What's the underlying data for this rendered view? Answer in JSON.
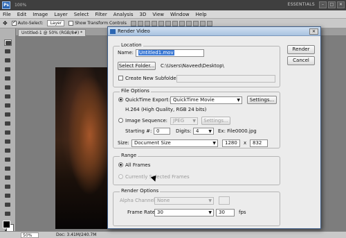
{
  "app": {
    "logo": "Ps",
    "zoom": "100%",
    "workspace": "ESSENTIALS",
    "window_buttons": [
      "–",
      "□",
      "✕"
    ]
  },
  "menu": [
    "File",
    "Edit",
    "Image",
    "Layer",
    "Select",
    "Filter",
    "Analysis",
    "3D",
    "View",
    "Window",
    "Help"
  ],
  "options_bar": {
    "auto_select_label": "Auto-Select:",
    "auto_select_value": "Layer",
    "transform_label": "Show Transform Controls"
  },
  "document": {
    "tab_title": "Untitled-1 @ 50% (RGB/8#) *",
    "zoom": "50%",
    "doc_size": "Doc: 3.41M/240.7M"
  },
  "dialog": {
    "title": "Render Video",
    "render_button": "Render",
    "cancel_button": "Cancel",
    "location": {
      "group_label": "Location",
      "name_label": "Name:",
      "name_value": "Untitled1.mov",
      "select_folder_button": "Select Folder...",
      "folder_path": "C:\\Users\\Naveed\\Desktop\\",
      "create_subfolder_label": "Create New Subfolder:"
    },
    "file_options": {
      "group_label": "File Options",
      "quicktime_label": "QuickTime Export:",
      "quicktime_format": "QuickTime Movie",
      "settings_button": "Settings...",
      "codec_info": "H.264 (High Quality, RGB 24 bits)",
      "image_sequence_label": "Image Sequence:",
      "image_sequence_format": "JPEG",
      "settings_button_2": "Settings...",
      "starting_label": "Starting #:",
      "starting_value": "0",
      "digits_label": "Digits:",
      "digits_value": "4",
      "example": "Ex: File0000.jpg",
      "size_label": "Size:",
      "size_value": "Document Size",
      "width_value": "1280",
      "times": "x",
      "height_value": "832"
    },
    "range": {
      "group_label": "Range",
      "all_frames_label": "All Frames",
      "selected_frames_label": "Currently Selected Frames"
    },
    "render_options": {
      "group_label": "Render Options",
      "alpha_label": "Alpha Channel:",
      "alpha_value": "None",
      "frame_rate_label": "Frame Rate:",
      "frame_rate_value": "30",
      "fps_value": "30",
      "fps_label": "fps"
    }
  }
}
